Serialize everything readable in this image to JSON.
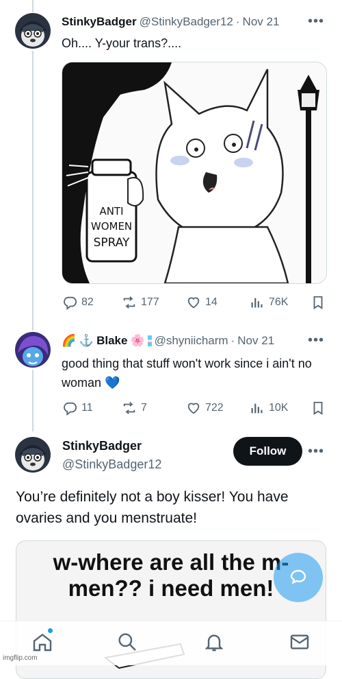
{
  "tweet1": {
    "name": "StinkyBadger",
    "handle": "@StinkyBadger12",
    "separator": "·",
    "date": "Nov 21",
    "text": "Oh.... Y-your trans?....",
    "media": {
      "can_label": [
        "ANTI",
        "WOMEN",
        "SPRAY"
      ]
    },
    "stats": {
      "replies": "82",
      "reposts": "177",
      "likes": "14",
      "views": "76K"
    }
  },
  "tweet2": {
    "name_prefix_emoji": "🌈 ⚓",
    "name": "Blake",
    "name_suffix_emoji": "🌸",
    "handle": "@shyniicharm",
    "separator": "·",
    "date": "Nov 21",
    "text": "good thing that stuff won't work since i ain't no woman",
    "heart_emoji": "💙",
    "stats": {
      "replies": "11",
      "reposts": "7",
      "likes": "722",
      "views": "10K"
    }
  },
  "main_tweet": {
    "name": "StinkyBadger",
    "handle": "@StinkyBadger12",
    "follow_label": "Follow",
    "text": "You’re definitely not a boy kisser! You have ovaries and you menstruate!",
    "meme_text": "w-where are all the m-men?? i need men!"
  },
  "watermark": "imgflip.com",
  "colors": {
    "accent": "#1d9bf0",
    "text": "#0f1419",
    "muted": "#536471",
    "border": "#cfd9de"
  },
  "icons": [
    "reply-icon",
    "repost-icon",
    "like-icon",
    "views-icon",
    "bookmark-icon",
    "home-icon",
    "search-icon",
    "notifications-icon",
    "messages-icon",
    "compose-icon"
  ]
}
